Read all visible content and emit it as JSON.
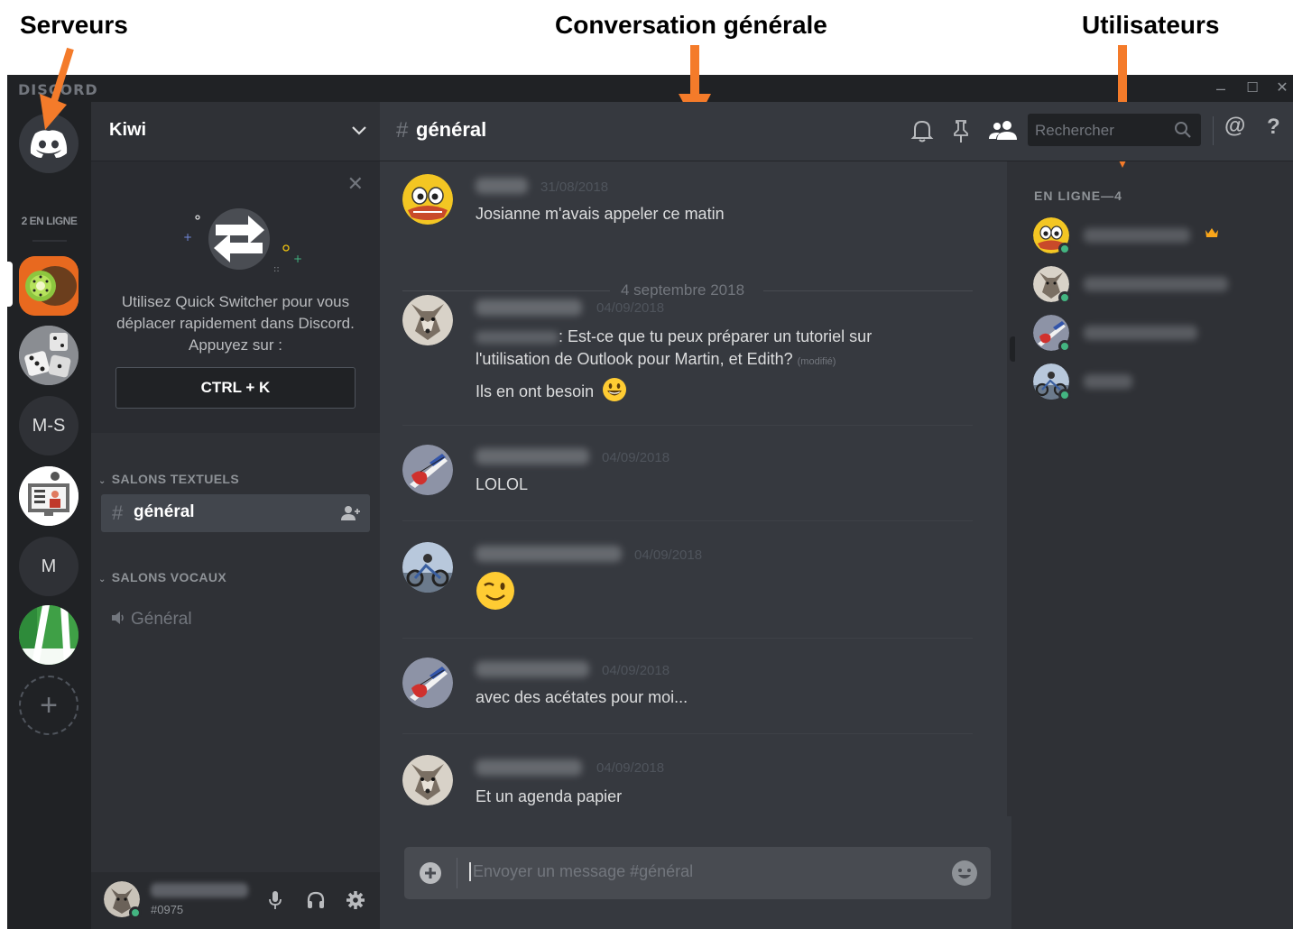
{
  "annotations": {
    "servers": "Serveurs",
    "conversation": "Conversation générale",
    "users": "Utilisateurs",
    "arrow_color": "#f47b2a"
  },
  "window": {
    "brand": "DISCORD",
    "controls": {
      "minimize": "–",
      "maximize": "☐",
      "close": "✕"
    }
  },
  "servers": {
    "online_count": "2 EN LIGNE",
    "items": [
      {
        "name": "home",
        "icon": "discord-logo-icon"
      },
      {
        "name": "kiwi",
        "icon": "kiwi-icon"
      },
      {
        "name": "dice",
        "icon": "dice-icon"
      },
      {
        "name": "M-S",
        "label": "M-S"
      },
      {
        "name": "presentation",
        "icon": "presentation-icon"
      },
      {
        "name": "M",
        "label": "M"
      },
      {
        "name": "green",
        "icon": "green-field-icon"
      }
    ],
    "add_label": "+"
  },
  "guild": {
    "name": "Kiwi",
    "quick_switcher": {
      "text": "Utilisez Quick Switcher pour vous déplacer rapidement dans Discord. Appuyez sur :",
      "shortcut": "CTRL + K"
    },
    "categories": {
      "text": "SALONS TEXTUELS",
      "voice": "SALONS VOCAUX"
    },
    "text_channel": "général",
    "voice_channel": "Général"
  },
  "user_panel": {
    "tag": "#0975"
  },
  "chat": {
    "channel": "général",
    "search_placeholder": "Rechercher",
    "at_label": "@",
    "help_label": "?",
    "day_separator": "4 septembre 2018",
    "messages": [
      {
        "time": "31/08/2018",
        "lines": [
          "Josianne m'avais appeler ce matin"
        ]
      },
      {
        "time": "04/09/2018",
        "lines": [
          ": Est-ce que tu peux préparer un tutoriel sur",
          "l'utilisation de Outlook pour Martin, et Edith?",
          "Ils en ont besoin"
        ],
        "edited": "(modifié)"
      },
      {
        "time": "04/09/2018",
        "lines": [
          "LOLOL"
        ]
      },
      {
        "time": "04/09/2018",
        "lines": []
      },
      {
        "time": "04/09/2018",
        "lines": [
          "avec des acétates pour moi..."
        ]
      },
      {
        "time": "04/09/2018",
        "lines": [
          "Et un agenda papier"
        ]
      }
    ],
    "composer_placeholder": "Envoyer un message #général"
  },
  "members": {
    "header": "EN LIGNE—4"
  },
  "colors": {
    "bg_dark": "#202225",
    "bg_mid": "#2f3136",
    "bg_chat": "#36393f",
    "online": "#43b581",
    "text": "#dcddde",
    "muted": "#72767d",
    "crown": "#faa61a"
  }
}
